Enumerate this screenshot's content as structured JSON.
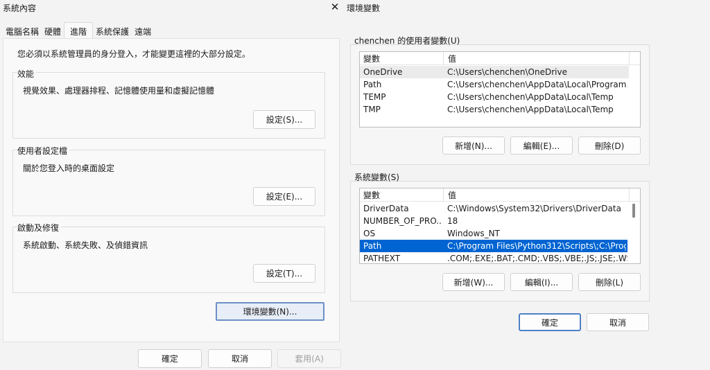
{
  "left_dialog": {
    "title": "系統內容",
    "tabs": [
      {
        "label": "電腦名稱"
      },
      {
        "label": "硬體"
      },
      {
        "label": "進階"
      },
      {
        "label": "系統保護"
      },
      {
        "label": "遠端"
      }
    ],
    "admin_note": "您必須以系統管理員的身分登入，才能變更這裡的大部分設定。",
    "groups": [
      {
        "label": "效能",
        "description": "視覺效果、處理器排程、記憶體使用量和虛擬記憶體",
        "button": "設定(S)..."
      },
      {
        "label": "使用者設定檔",
        "description": "關於您登入時的桌面設定",
        "button": "設定(E)..."
      },
      {
        "label": "啟動及修復",
        "description": "系統啟動、系統失敗、及偵錯資訊",
        "button": "設定(T)..."
      }
    ],
    "env_button": "環境變數(N)...",
    "ok": "確定",
    "cancel": "取消",
    "apply": "套用(A)"
  },
  "right_dialog": {
    "title": "環境變數",
    "user_section": {
      "label": "chenchen 的使用者變數(U)",
      "columns": [
        "變數",
        "值"
      ],
      "rows": [
        {
          "name": "OneDrive",
          "value": "C:\\Users\\chenchen\\OneDrive"
        },
        {
          "name": "Path",
          "value": "C:\\Users\\chenchen\\AppData\\Local\\Program..."
        },
        {
          "name": "TEMP",
          "value": "C:\\Users\\chenchen\\AppData\\Local\\Temp"
        },
        {
          "name": "TMP",
          "value": "C:\\Users\\chenchen\\AppData\\Local\\Temp"
        }
      ],
      "new": "新增(N)...",
      "edit": "編輯(E)...",
      "delete": "刪除(D)"
    },
    "system_section": {
      "label": "系統變數(S)",
      "columns": [
        "變數",
        "值"
      ],
      "rows": [
        {
          "name": "DriverData",
          "value": "C:\\Windows\\System32\\Drivers\\DriverData"
        },
        {
          "name": "NUMBER_OF_PRO...",
          "value": "18"
        },
        {
          "name": "OS",
          "value": "Windows_NT"
        },
        {
          "name": "Path",
          "value": "C:\\Program Files\\Python312\\Scripts\\;C:\\Prog..."
        },
        {
          "name": "PATHEXT",
          "value": ".COM;.EXE;.BAT;.CMD;.VBS;.VBE;.JS;.JSE;.WSF;..."
        }
      ],
      "new": "新增(W)...",
      "edit": "編輯(I)...",
      "delete": "刪除(L)"
    },
    "ok": "確定",
    "cancel": "取消"
  },
  "icons": {
    "close": "close-icon"
  },
  "colors": {
    "selection": "#0064d2",
    "focus_border": "#4d80c6"
  }
}
